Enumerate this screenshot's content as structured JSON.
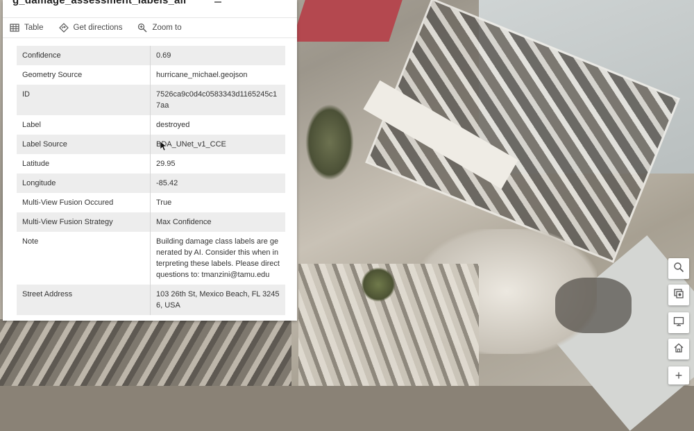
{
  "popup": {
    "title": "g_damage_assessment_labels_all",
    "actions": [
      {
        "label": "Table",
        "icon": "table-icon"
      },
      {
        "label": "Get directions",
        "icon": "directions-icon"
      },
      {
        "label": "Zoom to",
        "icon": "zoom-to-icon"
      }
    ],
    "attributes": [
      {
        "key": "Confidence",
        "value": "0.69"
      },
      {
        "key": "Geometry Source",
        "value": "hurricane_michael.geojson"
      },
      {
        "key": "ID",
        "value": "7526ca9c0d4c0583343d1165245c17aa"
      },
      {
        "key": "Label",
        "value": "destroyed"
      },
      {
        "key": "Label Source",
        "value": "BDA_UNet_v1_CCE"
      },
      {
        "key": "Latitude",
        "value": "29.95"
      },
      {
        "key": "Longitude",
        "value": "-85.42"
      },
      {
        "key": "Multi-View Fusion Occured",
        "value": "True"
      },
      {
        "key": "Multi-View Fusion Strategy",
        "value": "Max Confidence"
      },
      {
        "key": "Note",
        "value": "Building damage class labels are generated by AI. Consider this when interpreting these labels. Please direct questions to: tmanzini@tamu.edu"
      },
      {
        "key": "Street Address",
        "value": "103 26th St, Mexico Beach, FL 32456, USA"
      }
    ]
  },
  "map_tools": [
    {
      "icon": "search-icon"
    },
    {
      "icon": "layer-list-icon"
    },
    {
      "icon": "screen-icon"
    },
    {
      "icon": "home-icon"
    },
    {
      "icon": "zoom-in-icon",
      "symbol": "+"
    }
  ]
}
